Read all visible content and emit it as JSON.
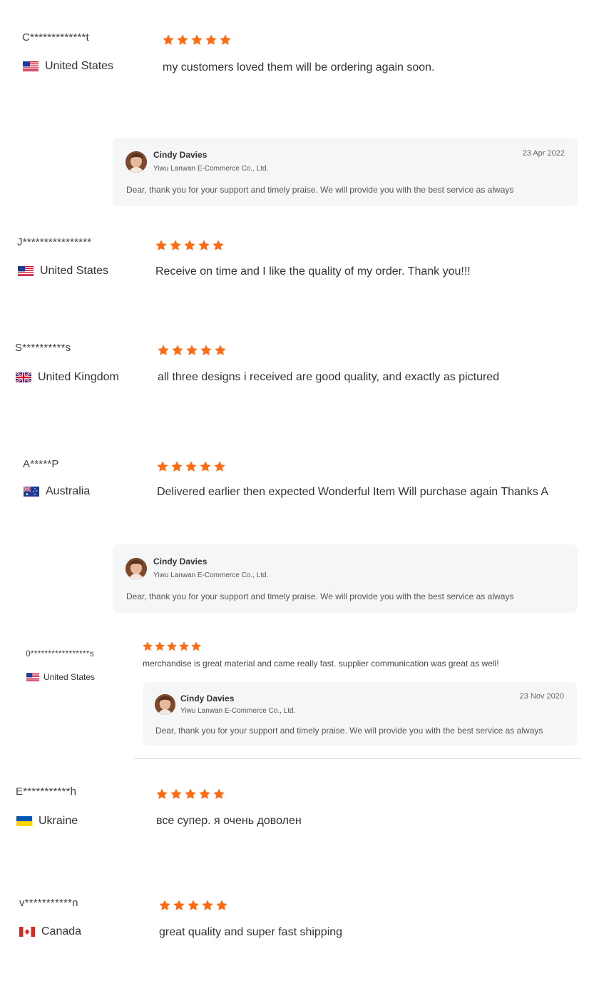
{
  "colors": {
    "star": "#ff6a13",
    "reply_bg": "#f5f6f8"
  },
  "reviews": [
    {
      "name": "C*************t",
      "country": "United States",
      "flag": "us-flag",
      "rating": 5,
      "text": "my customers loved them will be ordering again soon."
    },
    {
      "name": "J****************",
      "country": "United States",
      "flag": "us-flag",
      "rating": 5,
      "text": "Receive on time and I like the quality of my order. Thank you!!!"
    },
    {
      "name": "S**********s",
      "country": "United Kingdom",
      "flag": "uk-flag",
      "rating": 5,
      "text": "all three designs i received are good quality, and exactly as pictured"
    },
    {
      "name": "A*****P",
      "country": "Australia",
      "flag": "australia-flag",
      "rating": 5,
      "text": "Delivered earlier then expected Wonderful Item Will purchase again Thanks A"
    },
    {
      "name": "0*****************s",
      "country": "United States",
      "flag": "us-flag",
      "rating": 5,
      "text": "merchandise is great material and came really fast. supplier communication was great as well!"
    },
    {
      "name": "E***********h",
      "country": "Ukraine",
      "flag": "ukraine-flag",
      "rating": 5,
      "text": "все супер. я очень доволен"
    },
    {
      "name": "v***********n",
      "country": "Canada",
      "flag": "canada-flag",
      "rating": 5,
      "text": "great quality and super fast shipping"
    }
  ],
  "replies": [
    {
      "name": "Cindy Davies",
      "company": "Yiwu Lanwan E-Commerce Co., Ltd.",
      "date": "23 Apr 2022",
      "message": "Dear, thank you for your support and timely praise.  We will provide you with the best service as always"
    },
    {
      "name": "Cindy Davies",
      "company": "Yiwu Lanwan E-Commerce Co., Ltd.",
      "date": "",
      "message": "Dear, thank you for your support and timely praise.  We will provide you with the best service as always"
    },
    {
      "name": "Cindy Davies",
      "company": "Yiwu Lanwan E-Commerce Co., Ltd.",
      "date": "23 Nov 2020",
      "message": "Dear, thank you for your support and timely praise.  We will provide you with the best service as always"
    }
  ]
}
